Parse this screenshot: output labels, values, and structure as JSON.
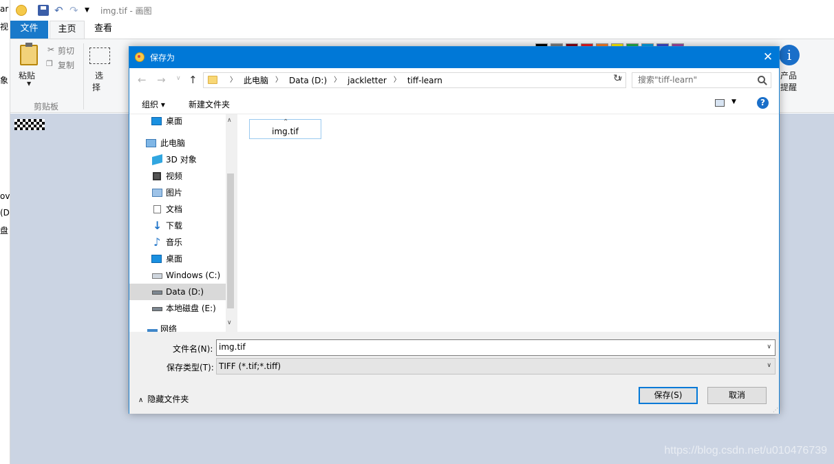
{
  "paint": {
    "title": "img.tif - 画图",
    "tabs": {
      "file": "文件",
      "home": "主页",
      "view": "查看"
    },
    "ribbon": {
      "paste": "粘贴",
      "cut": "剪切",
      "copy": "复制",
      "clipboard_group": "剪贴板",
      "select_top": "选",
      "select_bottom": "择",
      "product_alert_1": "产品",
      "product_alert_2": "提醒"
    },
    "colors": [
      "#000000",
      "#7f7f7f",
      "#880015",
      "#ed1c24",
      "#ff7f27",
      "#fff200",
      "#22b14c",
      "#00a2e8",
      "#3f48cc",
      "#a349a4"
    ],
    "left_fragments": [
      "ar",
      "视",
      "象",
      "ov",
      "(D",
      "盘"
    ]
  },
  "dialog": {
    "title": "保存为",
    "breadcrumb": [
      "此电脑",
      "Data (D:)",
      "jackletter",
      "tiff-learn"
    ],
    "search_placeholder": "搜索\"tiff-learn\"",
    "toolbar": {
      "organize": "组织 ▾",
      "new_folder": "新建文件夹",
      "help": "?"
    },
    "nav_items": [
      {
        "label": "桌面",
        "icon": "desktop-icon"
      },
      {
        "label": "此电脑",
        "icon": "computer-icon"
      },
      {
        "label": "3D 对象",
        "icon": "3d-objects-icon"
      },
      {
        "label": "视频",
        "icon": "video-icon"
      },
      {
        "label": "图片",
        "icon": "pictures-icon"
      },
      {
        "label": "文档",
        "icon": "documents-icon"
      },
      {
        "label": "下载",
        "icon": "download-icon"
      },
      {
        "label": "音乐",
        "icon": "music-icon"
      },
      {
        "label": "桌面",
        "icon": "desktop-icon"
      },
      {
        "label": "Windows (C:)",
        "icon": "drive-c-icon"
      },
      {
        "label": "Data (D:)",
        "icon": "drive-icon"
      },
      {
        "label": "本地磁盘 (E:)",
        "icon": "drive-icon"
      },
      {
        "label": "网络",
        "icon": "network-icon"
      }
    ],
    "files": [
      {
        "name": "img.tif"
      }
    ],
    "filename_label": "文件名(N):",
    "filename_value": "img.tif",
    "filetype_label": "保存类型(T):",
    "filetype_value": "TIFF (*.tif;*.tiff)",
    "hide_folders": "隐藏文件夹",
    "save_button": "保存(S)",
    "cancel_button": "取消"
  },
  "watermark": "https://blog.csdn.net/u010476739"
}
